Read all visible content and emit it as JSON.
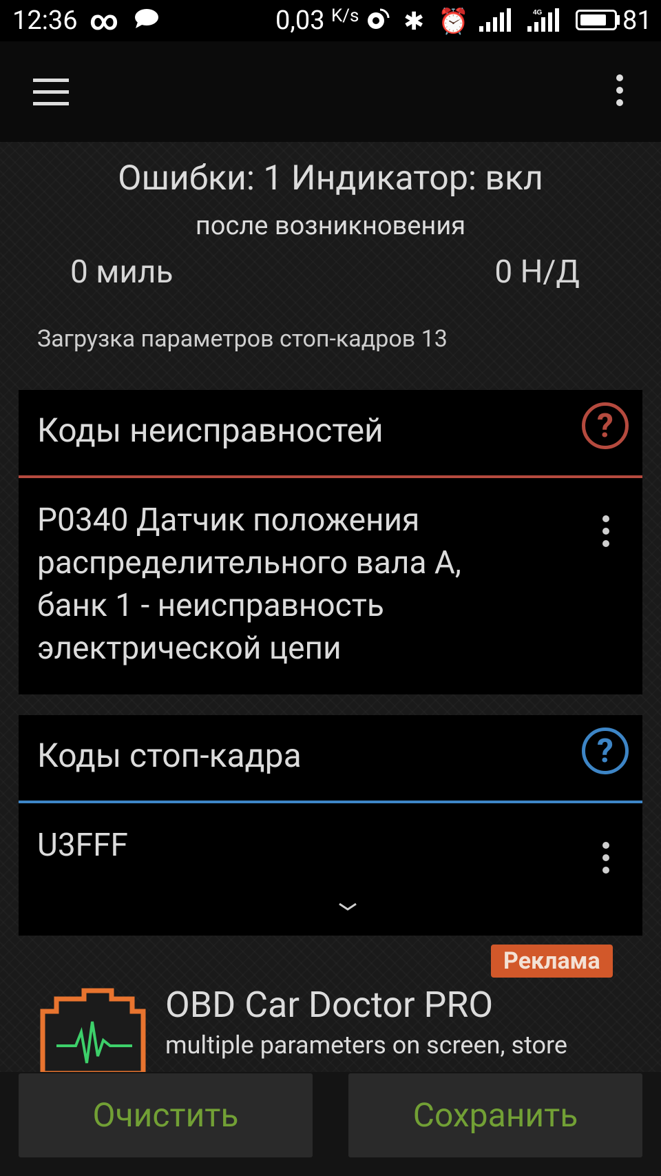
{
  "status_bar": {
    "time": "12:36",
    "infinity": "∞",
    "speed_value": "0,03",
    "speed_unit": "K/s",
    "bluetooth": "✱",
    "alarm": "⏰",
    "network_label": "4G",
    "battery": "81",
    "battery_fraction": 0.81
  },
  "summary": {
    "line1": "Ошибки: 1 Индикатор: вкл",
    "line2": "после возникновения",
    "distance_left": "0 миль",
    "distance_right": "0 Н/Д",
    "loading": "Загрузка параметров стоп-кадров 13"
  },
  "fault_codes": {
    "title": "Коды неисправностей",
    "help": "?",
    "accent": "#b54a3e",
    "items": [
      {
        "text": "P0340 Датчик положения распределительного вала А, банк 1 - неисправность электрической цепи"
      }
    ]
  },
  "freeze_frame": {
    "title": "Коды стоп-кадра",
    "help": "?",
    "accent": "#3d85c6",
    "items": [
      {
        "text": "U3FFF"
      }
    ]
  },
  "ad": {
    "badge": "Реклама",
    "title": "OBD Car Doctor PRO",
    "description": "multiple parameters on screen, store"
  },
  "footer": {
    "clear_label": "Очистить",
    "save_label": "Сохранить"
  }
}
